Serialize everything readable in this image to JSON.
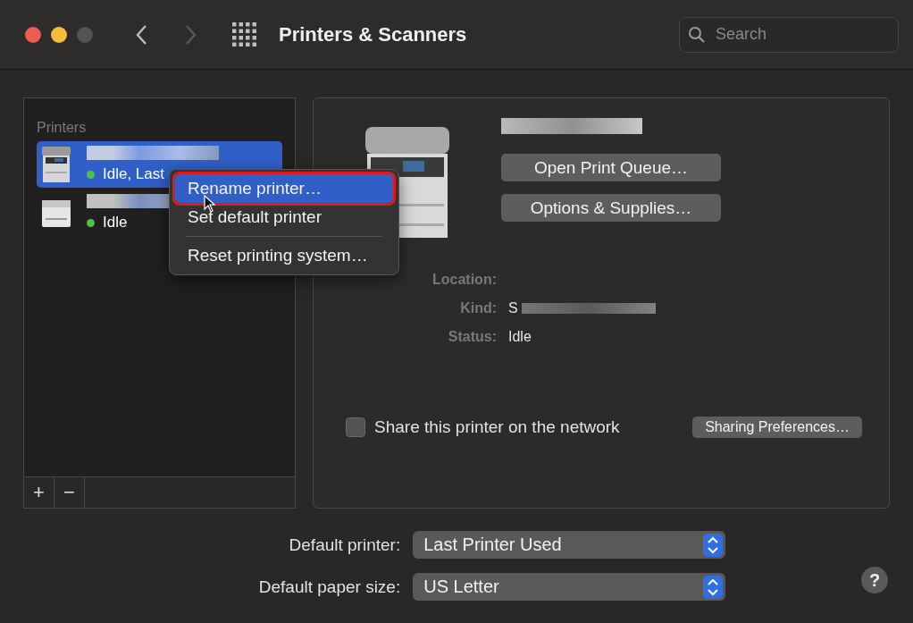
{
  "window": {
    "title": "Printers & Scanners",
    "forward_disabled": true
  },
  "search": {
    "placeholder": "Search"
  },
  "sidebar": {
    "heading": "Printers",
    "items": [
      {
        "kind": "multifunction",
        "status": "Idle, Last",
        "selected": true
      },
      {
        "kind": "laser",
        "status": "Idle",
        "selected": false
      }
    ],
    "add": "+",
    "remove": "−"
  },
  "context_menu": {
    "items": [
      {
        "label": "Rename printer…",
        "selected": true,
        "highlighted": true,
        "separator_before": false
      },
      {
        "label": "Set default printer",
        "selected": false,
        "highlighted": false,
        "separator_before": false
      },
      {
        "label": "Reset printing system…",
        "selected": false,
        "highlighted": false,
        "separator_before": true
      }
    ]
  },
  "details": {
    "buttons": [
      "Open Print Queue…",
      "Options & Supplies…"
    ],
    "fields": [
      {
        "label": "Location:",
        "redacted": false
      },
      {
        "label": "Kind:",
        "value": "S",
        "redacted": true
      },
      {
        "label": "Status:",
        "value": "Idle",
        "redacted": false
      }
    ],
    "share": {
      "label": "Share this printer on the network",
      "checked": false
    },
    "sharing_button": "Sharing Preferences…"
  },
  "defaults": [
    {
      "label": "Default printer:",
      "value": "Last Printer Used"
    },
    {
      "label": "Default paper size:",
      "value": "US Letter"
    }
  ],
  "help": "?"
}
